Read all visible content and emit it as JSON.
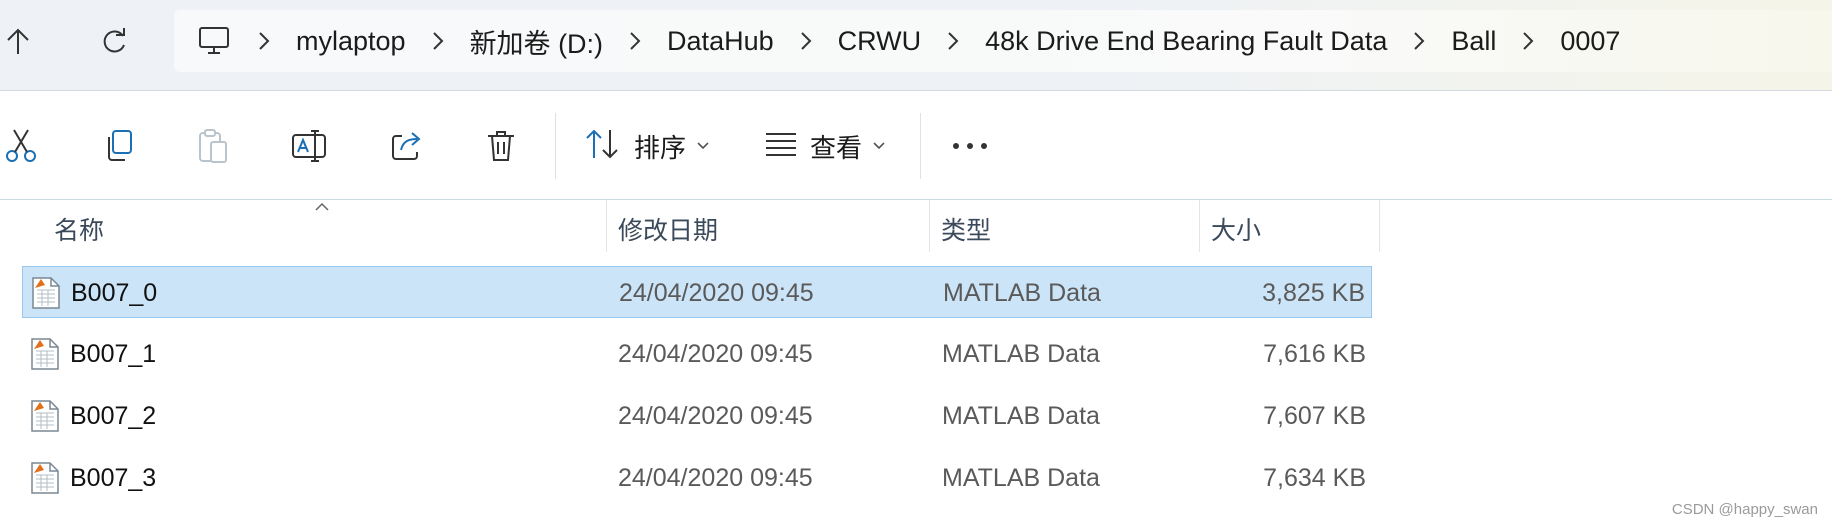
{
  "nav": {
    "breadcrumbs": [
      "mylaptop",
      "新加卷 (D:)",
      "DataHub",
      "CRWU",
      "48k Drive End Bearing Fault Data",
      "Ball",
      "0007"
    ]
  },
  "toolbar": {
    "sort_label": "排序",
    "view_label": "查看"
  },
  "columns": {
    "name": "名称",
    "modified": "修改日期",
    "type": "类型",
    "size": "大小"
  },
  "files": [
    {
      "name": "B007_0",
      "modified": "24/04/2020 09:45",
      "type": "MATLAB Data",
      "size": "3,825 KB",
      "selected": true
    },
    {
      "name": "B007_1",
      "modified": "24/04/2020 09:45",
      "type": "MATLAB Data",
      "size": "7,616 KB",
      "selected": false
    },
    {
      "name": "B007_2",
      "modified": "24/04/2020 09:45",
      "type": "MATLAB Data",
      "size": "7,607 KB",
      "selected": false
    },
    {
      "name": "B007_3",
      "modified": "24/04/2020 09:45",
      "type": "MATLAB Data",
      "size": "7,634 KB",
      "selected": false
    }
  ],
  "watermark": "CSDN @happy_swan",
  "colors": {
    "selection_bg": "#cce4f7",
    "selection_border": "#99c9ef",
    "accent": "#0067c0"
  }
}
